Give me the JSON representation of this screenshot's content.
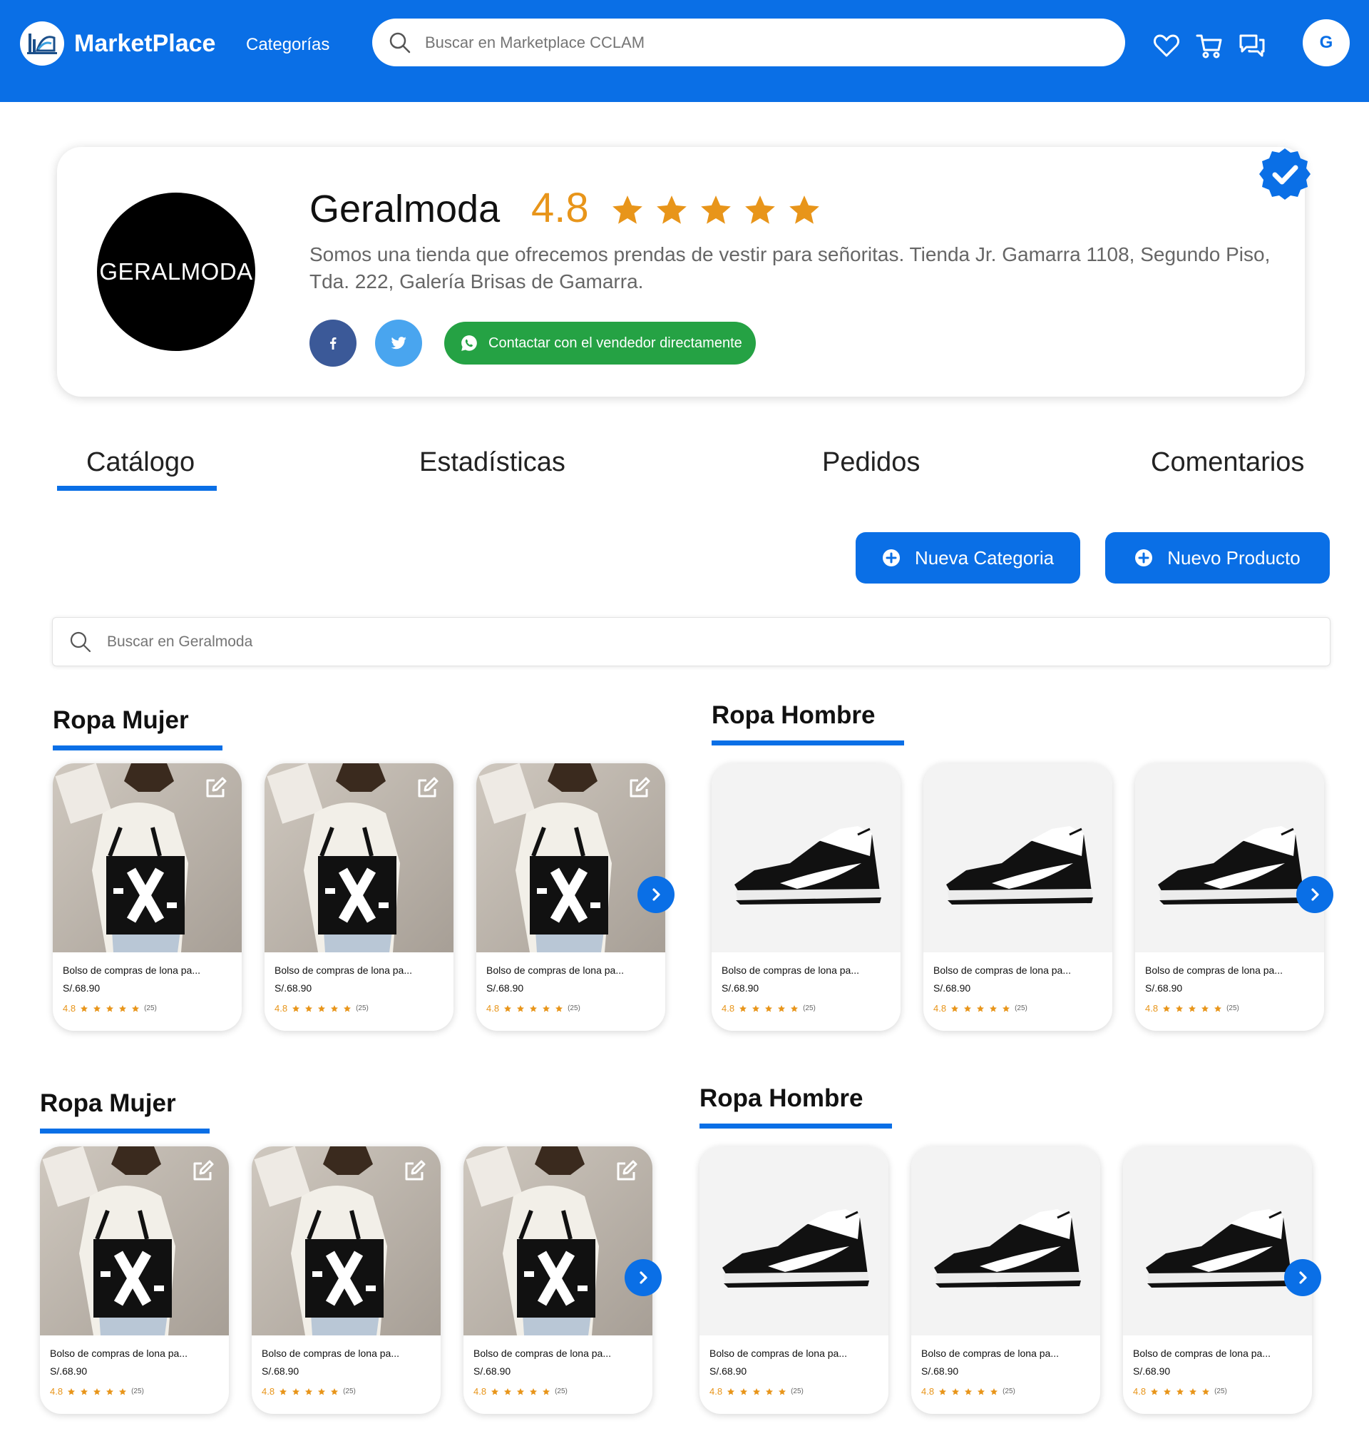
{
  "header": {
    "brand": "MarketPlace",
    "nav_categories": "Categorías",
    "search_placeholder": "Buscar en Marketplace CCLAM",
    "avatar_initial": "G",
    "colors": {
      "primary": "#0a6fe6",
      "accent_orange": "#e8951a",
      "whatsapp_green": "#25a244",
      "facebook": "#3b5998",
      "twitter": "#49a5ef"
    }
  },
  "store": {
    "logo_text": "GERALMODA",
    "name": "Geralmoda",
    "rating": "4.8",
    "stars": 5,
    "description": "Somos una tienda que ofrecemos prendas de vestir para señoritas. Tienda Jr. Gamarra 1108, Segundo Piso, Tda. 222, Galería Brisas de Gamarra.",
    "contact_label": "Contactar con el vendedor directamente",
    "verified": true
  },
  "tabs": [
    {
      "label": "Catálogo",
      "active": true
    },
    {
      "label": "Estadísticas",
      "active": false
    },
    {
      "label": "Pedidos",
      "active": false
    },
    {
      "label": "Comentarios",
      "active": false
    }
  ],
  "actions": {
    "new_category": "Nueva Categoria",
    "new_product": "Nuevo Producto"
  },
  "store_search_placeholder": "Buscar en Geralmoda",
  "sections": [
    {
      "title": "Ropa Mujer",
      "image": "bag",
      "editable": true,
      "products": [
        {
          "name": "Bolso de compras de lona pa...",
          "price": "S/.68.90",
          "rating": "4.8",
          "count": "(25)"
        },
        {
          "name": "Bolso de compras de lona pa...",
          "price": "S/.68.90",
          "rating": "4.8",
          "count": "(25)"
        },
        {
          "name": "Bolso de compras de lona pa...",
          "price": "S/.68.90",
          "rating": "4.8",
          "count": "(25)"
        }
      ]
    },
    {
      "title": "Ropa Hombre",
      "image": "sneaker",
      "editable": false,
      "products": [
        {
          "name": "Bolso de compras de lona pa...",
          "price": "S/.68.90",
          "rating": "4.8",
          "count": "(25)"
        },
        {
          "name": "Bolso de compras de lona pa...",
          "price": "S/.68.90",
          "rating": "4.8",
          "count": "(25)"
        },
        {
          "name": "Bolso de compras de lona pa...",
          "price": "S/.68.90",
          "rating": "4.8",
          "count": "(25)"
        }
      ]
    },
    {
      "title": "Ropa Mujer",
      "image": "bag",
      "editable": true,
      "products": [
        {
          "name": "Bolso de compras de lona pa...",
          "price": "S/.68.90",
          "rating": "4.8",
          "count": "(25)"
        },
        {
          "name": "Bolso de compras de lona pa...",
          "price": "S/.68.90",
          "rating": "4.8",
          "count": "(25)"
        },
        {
          "name": "Bolso de compras de lona pa...",
          "price": "S/.68.90",
          "rating": "4.8",
          "count": "(25)"
        }
      ]
    },
    {
      "title": "Ropa Hombre",
      "image": "sneaker",
      "editable": false,
      "products": [
        {
          "name": "Bolso de compras de lona pa...",
          "price": "S/.68.90",
          "rating": "4.8",
          "count": "(25)"
        },
        {
          "name": "Bolso de compras de lona pa...",
          "price": "S/.68.90",
          "rating": "4.8",
          "count": "(25)"
        },
        {
          "name": "Bolso de compras de lona pa...",
          "price": "S/.68.90",
          "rating": "4.8",
          "count": "(25)"
        }
      ]
    }
  ]
}
